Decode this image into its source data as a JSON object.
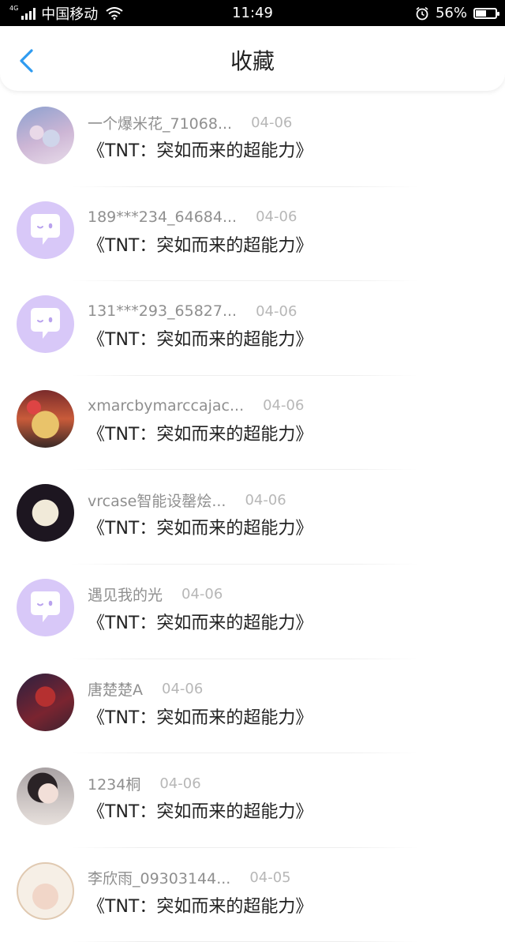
{
  "status_bar": {
    "network": "4G",
    "carrier": "中国移动",
    "time": "11:49",
    "battery": "56%",
    "battery_level": 0.56
  },
  "header": {
    "title": "收藏",
    "back_icon": "chevron-left-icon",
    "accent_color": "#2f9bf0"
  },
  "favorites": [
    {
      "username": "一个爆米花_71068...",
      "date": "04-06",
      "title": "《TNT：突如而来的超能力》",
      "avatar": "photo-group"
    },
    {
      "username": "189***234_64684...",
      "date": "04-06",
      "title": "《TNT：突如而来的超能力》",
      "avatar": "default-chat-icon"
    },
    {
      "username": "131***293_65827...",
      "date": "04-06",
      "title": "《TNT：突如而来的超能力》",
      "avatar": "default-chat-icon"
    },
    {
      "username": "xmarcbymarccajac...",
      "date": "04-06",
      "title": "《TNT：突如而来的超能力》",
      "avatar": "photo-food"
    },
    {
      "username": "vrcase智能设罄烩...",
      "date": "04-06",
      "title": "《TNT：突如而来的超能力》",
      "avatar": "photo-skull"
    },
    {
      "username": "遇见我的光",
      "date": "04-06",
      "title": "《TNT：突如而来的超能力》",
      "avatar": "default-chat-icon"
    },
    {
      "username": "唐楚楚A",
      "date": "04-06",
      "title": "《TNT：突如而来的超能力》",
      "avatar": "photo-art"
    },
    {
      "username": "1234桐",
      "date": "04-06",
      "title": "《TNT：突如而来的超能力》",
      "avatar": "photo-girl"
    },
    {
      "username": "李欣雨_09303144...",
      "date": "04-05",
      "title": "《TNT：突如而来的超能力》",
      "avatar": "photo-badge"
    }
  ]
}
